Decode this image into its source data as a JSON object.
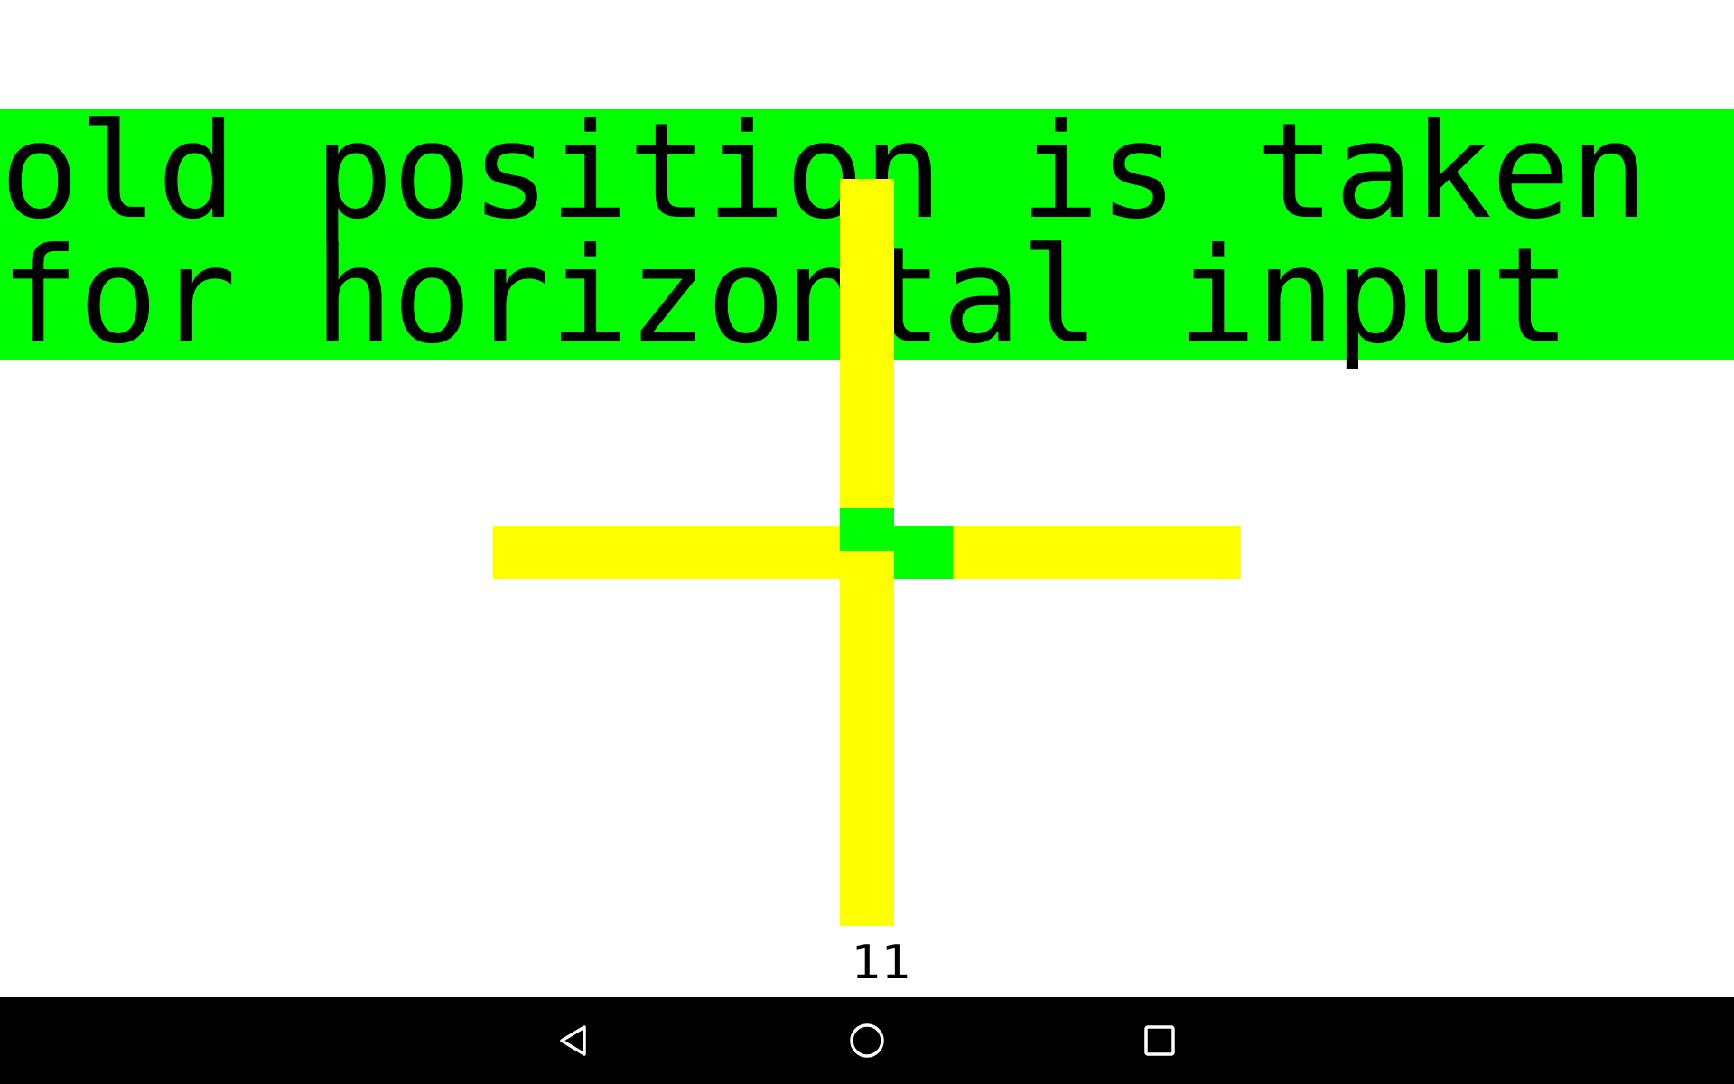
{
  "banner": {
    "line1": "old position is taken",
    "line2": "for horizontal input"
  },
  "counter": {
    "value": "11"
  },
  "colors": {
    "background": "#ffffff",
    "banner": "#00ff00",
    "crosshair": "#ffff00",
    "marker": "#00ff00",
    "text": "#000000",
    "navbar": "#000000",
    "nav_icon": "#ffffff"
  },
  "navbar": {
    "buttons": [
      {
        "icon": "back-triangle-icon"
      },
      {
        "icon": "home-circle-icon"
      },
      {
        "icon": "recents-square-icon"
      }
    ]
  }
}
